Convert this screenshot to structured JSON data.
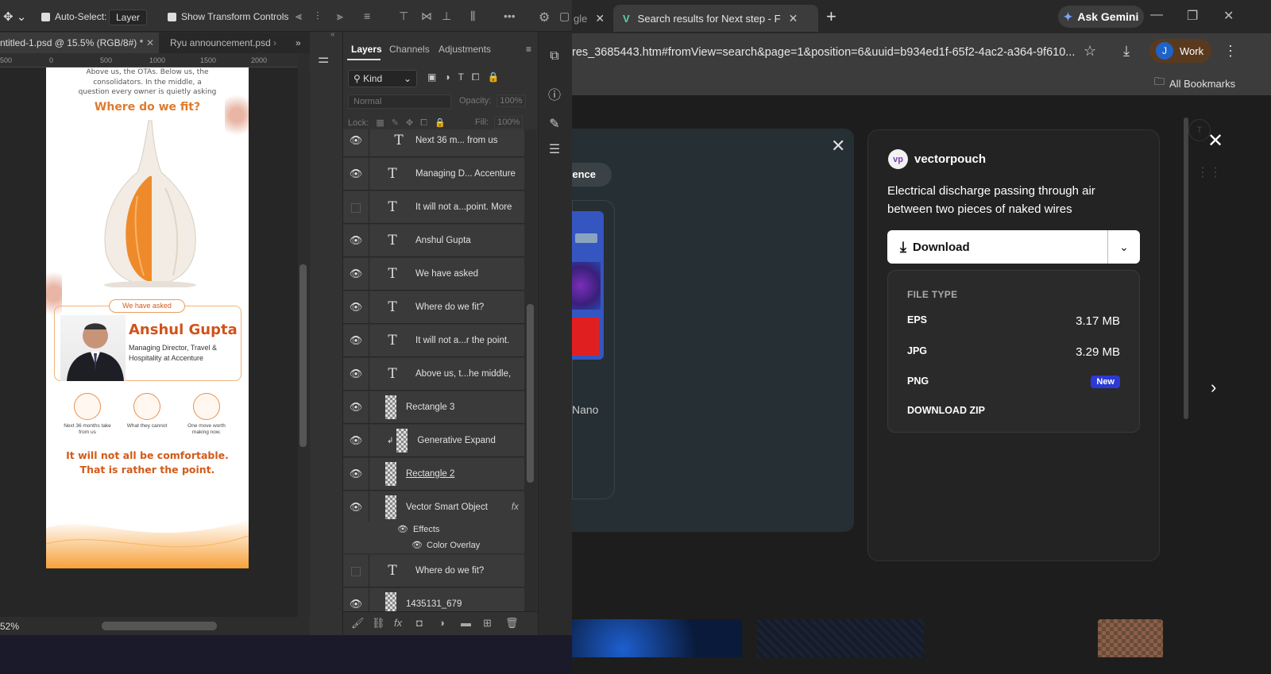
{
  "browser": {
    "tabs": [
      {
        "label": "gle",
        "active": false
      },
      {
        "label": "Search results for Next step - Fl",
        "active": true
      }
    ],
    "gemini_label": "Ask Gemini",
    "url": "res_3685443.htm#fromView=search&page=1&position=6&uuid=b934ed1f-65f2-4ac2-a364-9f610...",
    "profile_initial": "J",
    "profile_label": "Work",
    "bookmarks_label": "All Bookmarks"
  },
  "freepik": {
    "pill_label": "ence",
    "nano_label": "Nano",
    "author": "vectorpouch",
    "description": "Electrical discharge passing through air between two pieces of naked wires",
    "download_label": "Download",
    "file_type_title": "FILE TYPE",
    "files": [
      {
        "type": "EPS",
        "size": "3.17 MB"
      },
      {
        "type": "JPG",
        "size": "3.29 MB"
      },
      {
        "type": "PNG",
        "badge": "New"
      },
      {
        "type": "DOWNLOAD ZIP"
      }
    ]
  },
  "photoshop": {
    "options": {
      "auto_select_label": "Auto-Select:",
      "auto_select_value": "Layer",
      "transform_label": "Show Transform Controls"
    },
    "doc_tabs": [
      {
        "label": "ntitled-1.psd @ 15.5% (RGB/8#) *"
      },
      {
        "label": "Ryu announcement.psd"
      }
    ],
    "ruler_ticks": [
      "500",
      "0",
      "500",
      "1000",
      "1500",
      "2000"
    ],
    "zoom": "52%",
    "panel_tabs": [
      "Layers",
      "Channels",
      "Adjustments"
    ],
    "filter_kind": "Kind",
    "blend_mode": "Normal",
    "opacity_label": "Opacity:",
    "opacity_value": "100%",
    "lock_label": "Lock:",
    "fill_label": "Fill:",
    "fill_value": "100%",
    "layers": [
      {
        "name": "Next 36 m... from us",
        "kind": "text",
        "visible": true
      },
      {
        "name": "Managing D... Accenture",
        "kind": "text",
        "visible": true
      },
      {
        "name": "It will not a...point. More",
        "kind": "text",
        "visible": false
      },
      {
        "name": "Anshul Gupta",
        "kind": "text",
        "visible": true
      },
      {
        "name": "We have asked",
        "kind": "text",
        "visible": true
      },
      {
        "name": "Where do we fit?",
        "kind": "text",
        "visible": true
      },
      {
        "name": "It will not a...r the point.",
        "kind": "text",
        "visible": true
      },
      {
        "name": "Above us, t...he middle,",
        "kind": "text",
        "visible": true
      },
      {
        "name": "Rectangle 3",
        "kind": "shape",
        "visible": true
      },
      {
        "name": "Generative Expand",
        "kind": "smart",
        "visible": true
      },
      {
        "name": "Rectangle 2",
        "kind": "shape",
        "visible": true
      },
      {
        "name": "Vector Smart Object",
        "kind": "smart",
        "visible": true
      },
      {
        "name": "Where do we fit?",
        "kind": "text",
        "visible": false
      },
      {
        "name": "1435131_679",
        "kind": "smart",
        "visible": true
      }
    ],
    "effects_label": "Effects",
    "color_overlay_label": "Color Overlay",
    "fx_label": "fx"
  },
  "artboard": {
    "above_text": "Above us, the OTAs. Below us, the consolidators. In the middle, a question every owner is quietly asking",
    "where": "Where do we fit?",
    "pill": "We have asked",
    "name": "Anshul Gupta",
    "role": "Managing Director, Travel & Hospitality at Accenture",
    "icons": [
      {
        "caption": "Next 36 months take from us"
      },
      {
        "caption": "What they cannot"
      },
      {
        "caption": "One move worth making now."
      }
    ],
    "comfort_line1": "It will not all be comfortable.",
    "comfort_line2": "That is rather the point."
  },
  "colors": {
    "accent_orange": "#e07a2b",
    "new_badge": "#2c39d6"
  }
}
